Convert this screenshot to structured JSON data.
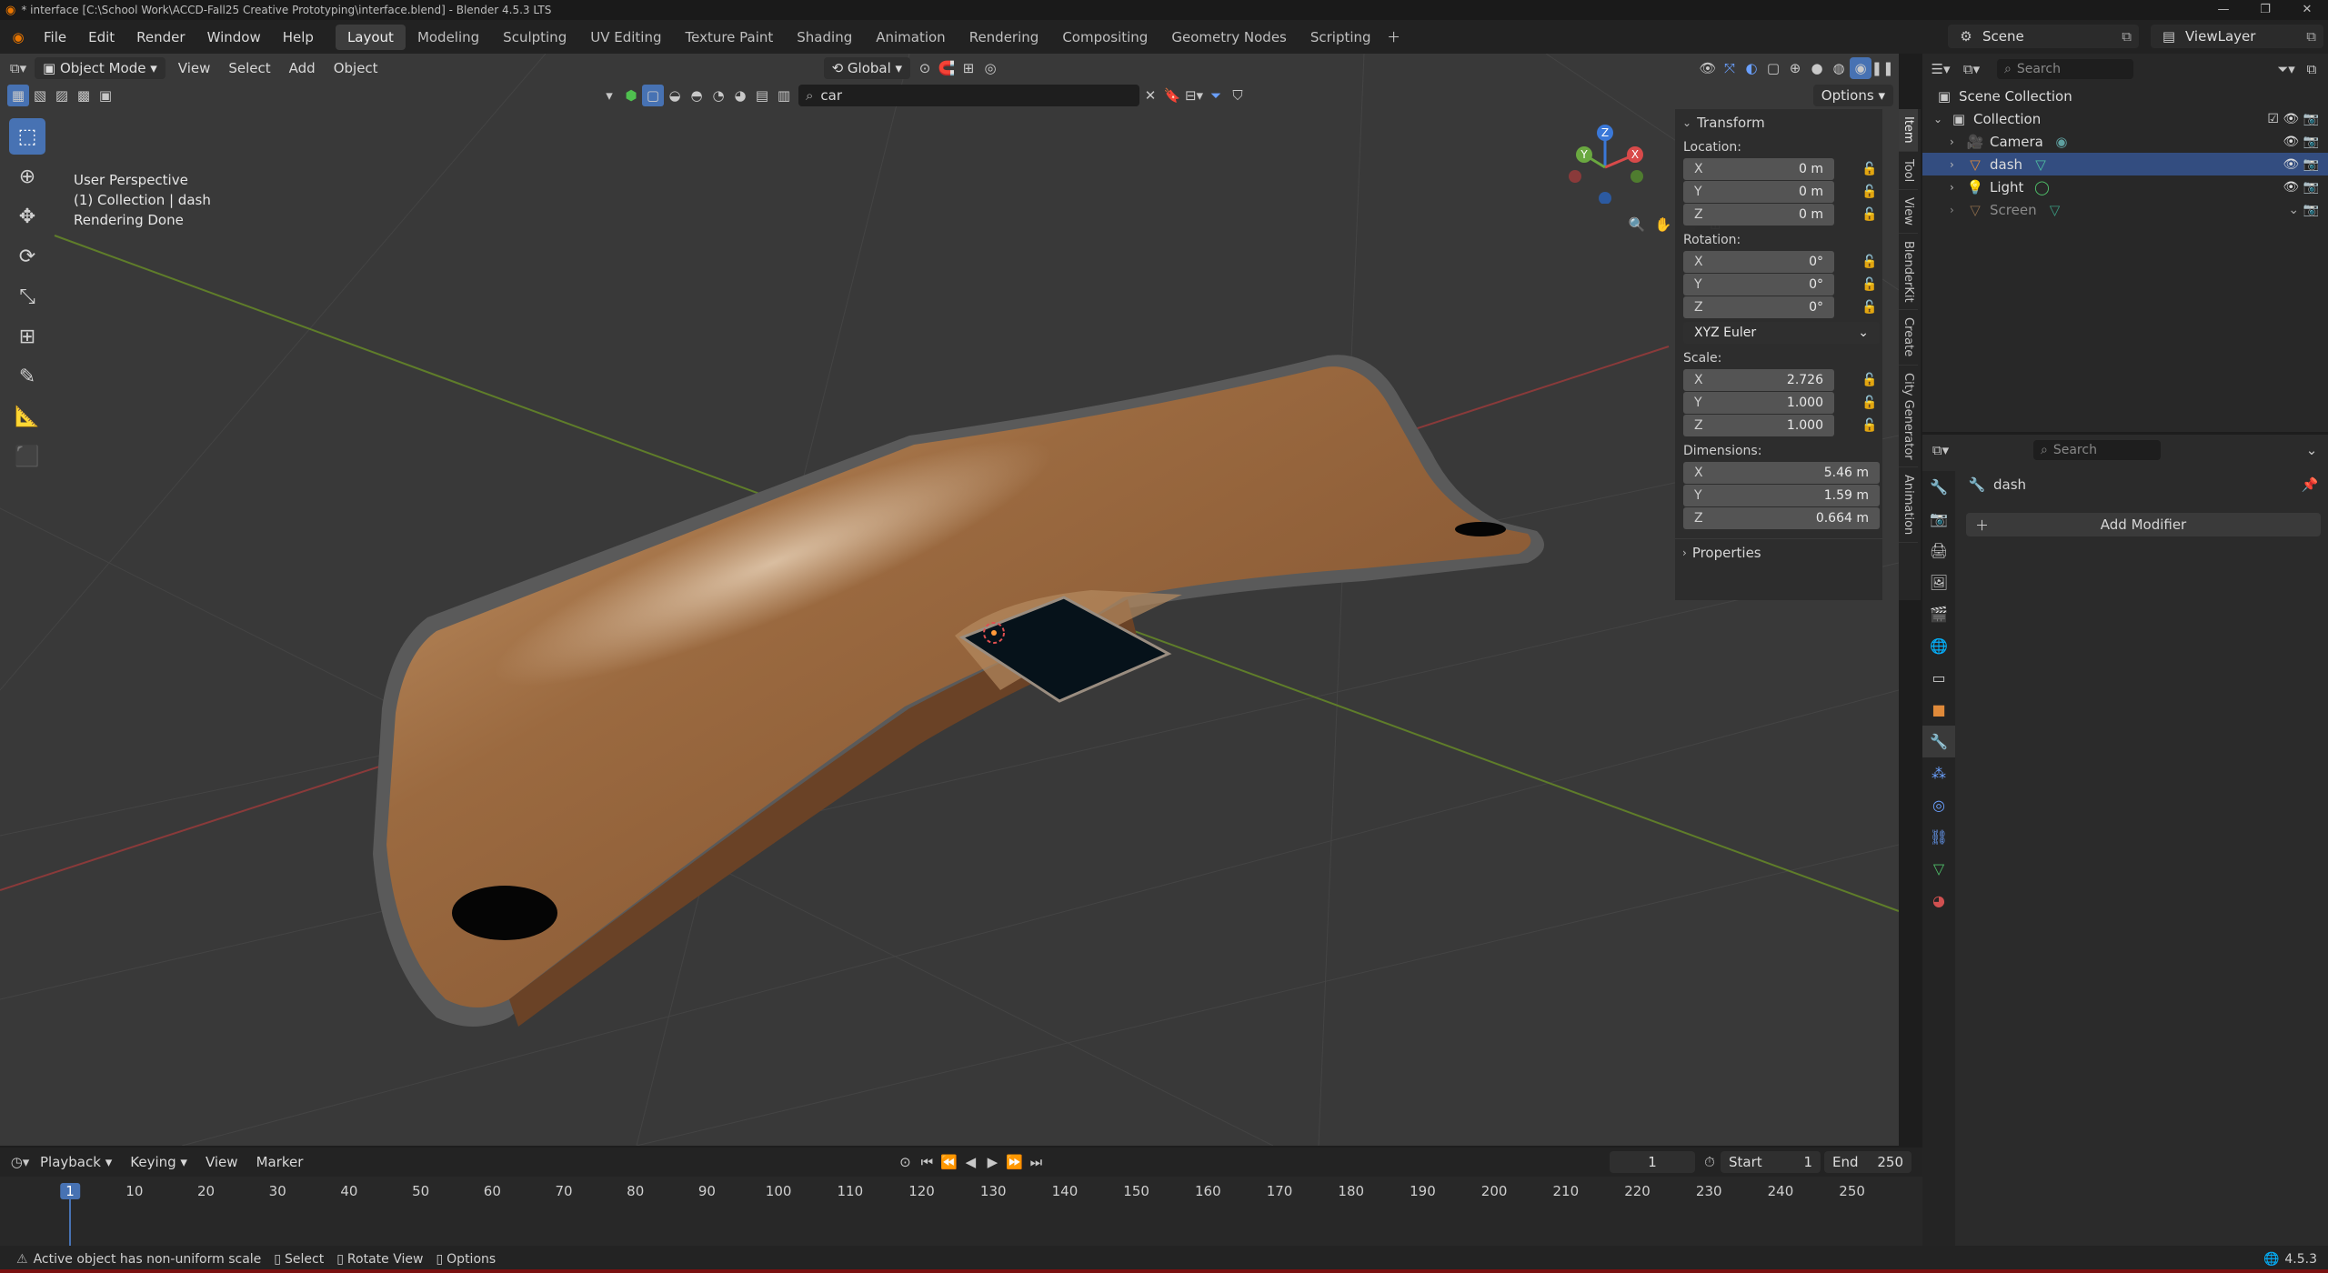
{
  "window": {
    "title": "* interface [C:\\School Work\\ACCD-Fall25 Creative Prototyping\\interface.blend] - Blender 4.5.3 LTS"
  },
  "menu": [
    "File",
    "Edit",
    "Render",
    "Window",
    "Help"
  ],
  "workspaces": [
    "Layout",
    "Modeling",
    "Sculpting",
    "UV Editing",
    "Texture Paint",
    "Shading",
    "Animation",
    "Rendering",
    "Compositing",
    "Geometry Nodes",
    "Scripting"
  ],
  "active_workspace": "Layout",
  "scene": {
    "name": "Scene",
    "view_layer": "ViewLayer"
  },
  "viewport_header": {
    "mode": "Object Mode",
    "menus": [
      "View",
      "Select",
      "Add",
      "Object"
    ],
    "orientation": "Global",
    "search_value": "car",
    "options_label": "Options"
  },
  "viewport_info": {
    "line1": "User Perspective",
    "line2": "(1) Collection | dash",
    "line3": "Rendering Done"
  },
  "gizmo": {
    "x": "X",
    "y": "Y",
    "z": "Z"
  },
  "npanel": {
    "section_title": "Transform",
    "location_label": "Location:",
    "location": [
      {
        "axis": "X",
        "value": "0 m"
      },
      {
        "axis": "Y",
        "value": "0 m"
      },
      {
        "axis": "Z",
        "value": "0 m"
      }
    ],
    "rotation_label": "Rotation:",
    "rotation": [
      {
        "axis": "X",
        "value": "0°"
      },
      {
        "axis": "Y",
        "value": "0°"
      },
      {
        "axis": "Z",
        "value": "0°"
      }
    ],
    "rotation_mode": "XYZ Euler",
    "scale_label": "Scale:",
    "scale": [
      {
        "axis": "X",
        "value": "2.726"
      },
      {
        "axis": "Y",
        "value": "1.000"
      },
      {
        "axis": "Z",
        "value": "1.000"
      }
    ],
    "dimensions_label": "Dimensions:",
    "dimensions": [
      {
        "axis": "X",
        "value": "5.46 m"
      },
      {
        "axis": "Y",
        "value": "1.59 m"
      },
      {
        "axis": "Z",
        "value": "0.664 m"
      }
    ],
    "properties_label": "Properties",
    "tabs": [
      "Item",
      "Tool",
      "View",
      "BlenderKit",
      "Create",
      "City Generator",
      "Animation"
    ]
  },
  "outliner": {
    "search_placeholder": "Search",
    "root": "Scene Collection",
    "collection": "Collection",
    "items": [
      {
        "name": "Camera",
        "selected": false
      },
      {
        "name": "dash",
        "selected": true
      },
      {
        "name": "Light",
        "selected": false
      },
      {
        "name": "Screen",
        "selected": false
      }
    ]
  },
  "properties": {
    "search_placeholder": "Search",
    "object_name": "dash",
    "add_modifier": "Add Modifier"
  },
  "timeline": {
    "menus": [
      "Playback",
      "Keying",
      "View",
      "Marker"
    ],
    "current_frame": "1",
    "start_label": "Start",
    "start": "1",
    "end_label": "End",
    "end": "250",
    "ticks": [
      "1",
      "10",
      "20",
      "30",
      "40",
      "50",
      "60",
      "70",
      "80",
      "90",
      "100",
      "110",
      "120",
      "130",
      "140",
      "150",
      "160",
      "170",
      "180",
      "190",
      "200",
      "210",
      "220",
      "230",
      "240",
      "250"
    ]
  },
  "status": {
    "warning": "Active object has non-uniform scale",
    "select": "Select",
    "rotate": "Rotate View",
    "options": "Options",
    "version": "4.5.3"
  },
  "colors": {
    "accent": "#4772b3",
    "selection": "#334d80",
    "brand": "#ea7600",
    "wood": "#8a5a35"
  }
}
